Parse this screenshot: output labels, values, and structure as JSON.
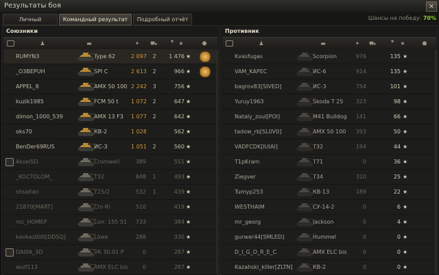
{
  "window": {
    "title": "Результаты боя",
    "close": "×"
  },
  "tabs": [
    "Личный результат",
    "Командный результат",
    "Подробный отчёт"
  ],
  "active_tab": 1,
  "chance_label": "Шансы на победу:",
  "chance_value": "70%",
  "allies": {
    "title": "Союзники",
    "rows": [
      {
        "name": "RUMYN3",
        "tank": "Type 62",
        "damage": "2 097",
        "kills": "2",
        "xp": "1 476",
        "alive": true,
        "medal": true,
        "hi": true
      },
      {
        "name": "_O3BEPUH",
        "tank": "SPI C",
        "damage": "2 613",
        "kills": "2",
        "xp": "966",
        "alive": true,
        "medal": true,
        "hi": false
      },
      {
        "name": "APPEL_8",
        "tank": "AMX 50 100",
        "damage": "2 242",
        "kills": "3",
        "xp": "756",
        "alive": true,
        "medal": false,
        "hi": false
      },
      {
        "name": "kuzik1985",
        "tank": "FCM 50 t",
        "damage": "1 072",
        "kills": "2",
        "xp": "647",
        "alive": true,
        "medal": false,
        "hi": false
      },
      {
        "name": "dimon_1000_539",
        "tank": "AMX 13 F3",
        "damage": "1 077",
        "kills": "2",
        "xp": "642",
        "alive": true,
        "medal": false,
        "hi": false
      },
      {
        "name": "oks70",
        "tank": "КВ-2",
        "damage": "1 028",
        "kills": "",
        "xp": "562",
        "alive": true,
        "medal": false,
        "hi": false
      },
      {
        "name": "BenDer69RUS",
        "tank": "ИС-3",
        "damage": "1 051",
        "kills": "2",
        "xp": "560",
        "alive": true,
        "medal": false,
        "hi": false
      },
      {
        "name": "Aksel5D",
        "tank": "Cromwell",
        "damage": "389",
        "kills": "",
        "xp": "551",
        "alive": false,
        "medal": false,
        "hi": false,
        "platoon": true
      },
      {
        "name": "_KOCTOLOM_",
        "tank": "T32",
        "damage": "848",
        "kills": "1",
        "xp": "493",
        "alive": false,
        "medal": false,
        "hi": false
      },
      {
        "name": "shsaitan",
        "tank": "T25/2",
        "damage": "532",
        "kills": "1",
        "xp": "439",
        "alive": false,
        "medal": false,
        "hi": false
      },
      {
        "name": "21870[MART]",
        "tank": "Chi-Ri",
        "damage": "510",
        "kills": "",
        "xp": "419",
        "alive": false,
        "medal": false,
        "hi": false
      },
      {
        "name": "roc_HOMEP",
        "tank": "Lorr. 155 51",
        "damage": "733",
        "kills": "",
        "xp": "384",
        "alive": false,
        "medal": false,
        "hi": false
      },
      {
        "name": "kavkaz000[DDSQ]",
        "tank": "Löwe",
        "damage": "288",
        "kills": "",
        "xp": "330",
        "alive": false,
        "medal": false,
        "hi": false
      },
      {
        "name": "DAIIIA_3D",
        "tank": "VK 30.01 P",
        "damage": "0",
        "kills": "",
        "xp": "287",
        "alive": false,
        "medal": false,
        "hi": false,
        "platoon": true
      },
      {
        "name": "wulf113",
        "tank": "AMX ELC bis",
        "damage": "0",
        "kills": "",
        "xp": "287",
        "alive": false,
        "medal": false,
        "hi": false
      }
    ]
  },
  "enemies": {
    "title": "Противник",
    "rows": [
      {
        "name": "Kvasfugas",
        "tank": "Scorpion",
        "damage": "976",
        "kills": "",
        "xp": "135"
      },
      {
        "name": "VAM_KAPEC",
        "tank": "ИС-6",
        "damage": "914",
        "kills": "",
        "xp": "135"
      },
      {
        "name": "bagrov83[SIVED]",
        "tank": "ИС-3",
        "damage": "754",
        "kills": "",
        "xp": "101"
      },
      {
        "name": "Yuruy1963",
        "tank": "Škoda T 25",
        "damage": "323",
        "kills": "",
        "xp": "98"
      },
      {
        "name": "Nataly_zoul[POI]",
        "tank": "M41 Bulldog",
        "damage": "141",
        "kills": "",
        "xp": "66"
      },
      {
        "name": "tadow_rb[SL0V0]",
        "tank": "AMX 50 100",
        "damage": "393",
        "kills": "",
        "xp": "50"
      },
      {
        "name": "VADFCDK[IUIAI]",
        "tank": "T32",
        "damage": "194",
        "kills": "",
        "xp": "44"
      },
      {
        "name": "T1pKram",
        "tank": "T71",
        "damage": "0",
        "kills": "",
        "xp": "36"
      },
      {
        "name": "Ziegver",
        "tank": "T34",
        "damage": "310",
        "kills": "",
        "xp": "25"
      },
      {
        "name": "Tumyp253",
        "tank": "КВ-13",
        "damage": "189",
        "kills": "",
        "xp": "22"
      },
      {
        "name": "WESTHAIM",
        "tank": "СУ-14-2",
        "damage": "0",
        "kills": "",
        "xp": "6"
      },
      {
        "name": "mr_georg",
        "tank": "Jackson",
        "damage": "0",
        "kills": "",
        "xp": "4"
      },
      {
        "name": "gurwer44[SMLED]",
        "tank": "Hummel",
        "damage": "0",
        "kills": "",
        "xp": "0"
      },
      {
        "name": "D_I_G_O_R_E_C",
        "tank": "AMX ELC bis",
        "damage": "0",
        "kills": "",
        "xp": "0"
      },
      {
        "name": "Kazahski_killer[ZLTN]",
        "tank": "КВ-2",
        "damage": "0",
        "kills": "",
        "xp": "0"
      }
    ]
  },
  "star": "★",
  "colors": {
    "accent": "#8fd12e",
    "damage": "#d29a3c",
    "ally_tank": "#b98a35",
    "enemy_tank": "#4a4741"
  }
}
